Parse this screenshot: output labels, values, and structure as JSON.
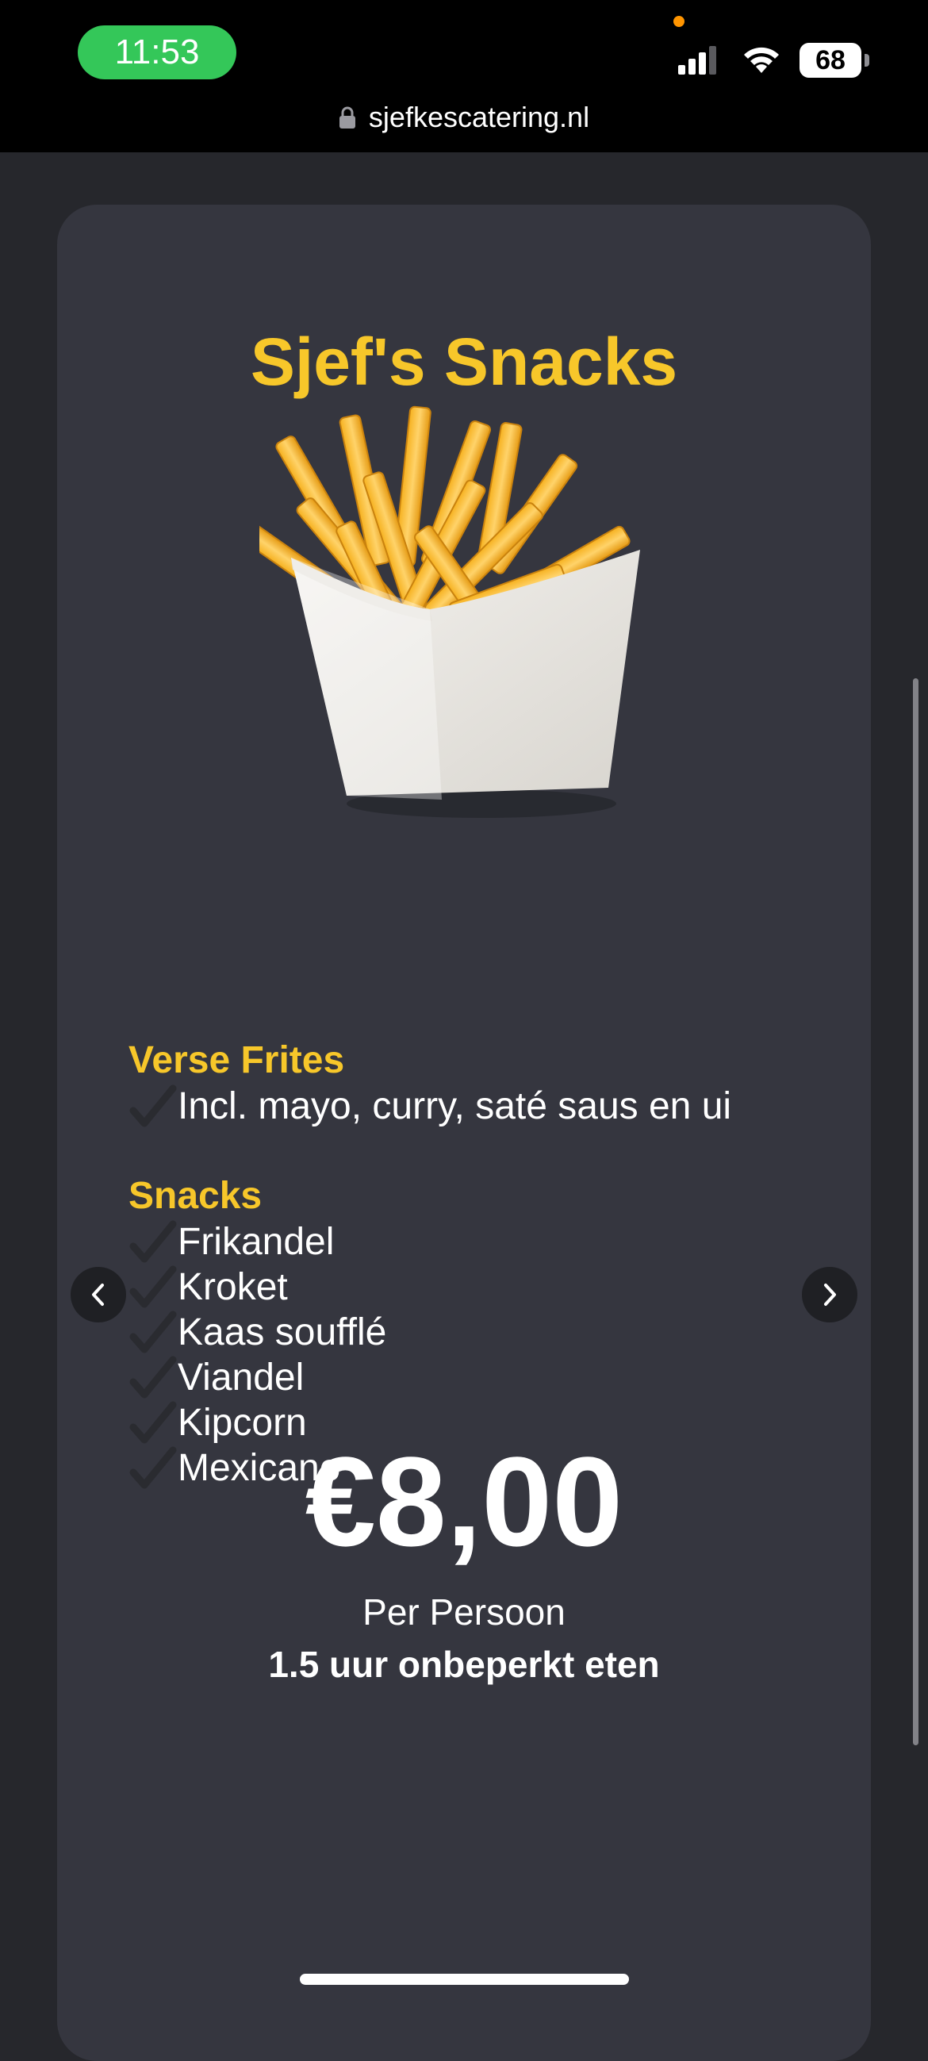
{
  "status_bar": {
    "time": "11:53",
    "battery": "68",
    "icons": [
      "signal-icon",
      "wifi-icon",
      "battery-icon"
    ]
  },
  "browser": {
    "url": "sjefkescatering.nl",
    "lock_icon": "lock-icon"
  },
  "card": {
    "title": "Sjef's Snacks",
    "image": "fries-image",
    "sections": [
      {
        "title": "Verse Frites",
        "items": [
          "Incl. mayo, curry, saté saus en ui"
        ]
      },
      {
        "title": "Snacks",
        "items": [
          "Frikandel",
          "Kroket",
          "Kaas soufflé",
          "Viandel",
          "Kipcorn",
          "Mexicano"
        ]
      }
    ],
    "price": "€8,00",
    "price_caption": "Per Persoon",
    "price_note": "1.5 uur onbeperkt eten"
  },
  "colors": {
    "accent": "#f7c72a",
    "card_bg": "#35363f",
    "page_bg": "#26272c",
    "time_pill": "#34c759"
  }
}
